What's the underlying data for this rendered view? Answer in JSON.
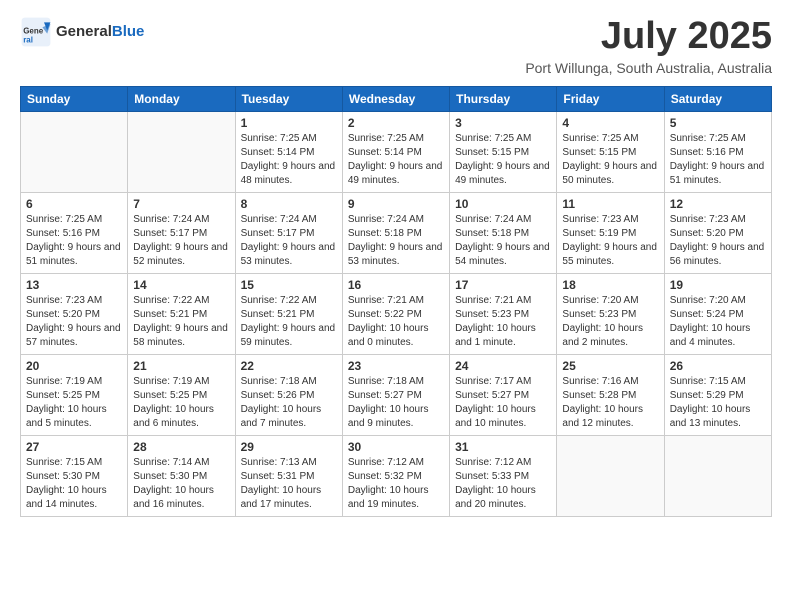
{
  "header": {
    "logo": {
      "general": "General",
      "blue": "Blue"
    },
    "title": "July 2025",
    "location": "Port Willunga, South Australia, Australia"
  },
  "weekdays": [
    "Sunday",
    "Monday",
    "Tuesday",
    "Wednesday",
    "Thursday",
    "Friday",
    "Saturday"
  ],
  "weeks": [
    [
      {
        "day": "",
        "sunrise": "",
        "sunset": "",
        "daylight": ""
      },
      {
        "day": "",
        "sunrise": "",
        "sunset": "",
        "daylight": ""
      },
      {
        "day": "1",
        "sunrise": "Sunrise: 7:25 AM",
        "sunset": "Sunset: 5:14 PM",
        "daylight": "Daylight: 9 hours and 48 minutes."
      },
      {
        "day": "2",
        "sunrise": "Sunrise: 7:25 AM",
        "sunset": "Sunset: 5:14 PM",
        "daylight": "Daylight: 9 hours and 49 minutes."
      },
      {
        "day": "3",
        "sunrise": "Sunrise: 7:25 AM",
        "sunset": "Sunset: 5:15 PM",
        "daylight": "Daylight: 9 hours and 49 minutes."
      },
      {
        "day": "4",
        "sunrise": "Sunrise: 7:25 AM",
        "sunset": "Sunset: 5:15 PM",
        "daylight": "Daylight: 9 hours and 50 minutes."
      },
      {
        "day": "5",
        "sunrise": "Sunrise: 7:25 AM",
        "sunset": "Sunset: 5:16 PM",
        "daylight": "Daylight: 9 hours and 51 minutes."
      }
    ],
    [
      {
        "day": "6",
        "sunrise": "Sunrise: 7:25 AM",
        "sunset": "Sunset: 5:16 PM",
        "daylight": "Daylight: 9 hours and 51 minutes."
      },
      {
        "day": "7",
        "sunrise": "Sunrise: 7:24 AM",
        "sunset": "Sunset: 5:17 PM",
        "daylight": "Daylight: 9 hours and 52 minutes."
      },
      {
        "day": "8",
        "sunrise": "Sunrise: 7:24 AM",
        "sunset": "Sunset: 5:17 PM",
        "daylight": "Daylight: 9 hours and 53 minutes."
      },
      {
        "day": "9",
        "sunrise": "Sunrise: 7:24 AM",
        "sunset": "Sunset: 5:18 PM",
        "daylight": "Daylight: 9 hours and 53 minutes."
      },
      {
        "day": "10",
        "sunrise": "Sunrise: 7:24 AM",
        "sunset": "Sunset: 5:18 PM",
        "daylight": "Daylight: 9 hours and 54 minutes."
      },
      {
        "day": "11",
        "sunrise": "Sunrise: 7:23 AM",
        "sunset": "Sunset: 5:19 PM",
        "daylight": "Daylight: 9 hours and 55 minutes."
      },
      {
        "day": "12",
        "sunrise": "Sunrise: 7:23 AM",
        "sunset": "Sunset: 5:20 PM",
        "daylight": "Daylight: 9 hours and 56 minutes."
      }
    ],
    [
      {
        "day": "13",
        "sunrise": "Sunrise: 7:23 AM",
        "sunset": "Sunset: 5:20 PM",
        "daylight": "Daylight: 9 hours and 57 minutes."
      },
      {
        "day": "14",
        "sunrise": "Sunrise: 7:22 AM",
        "sunset": "Sunset: 5:21 PM",
        "daylight": "Daylight: 9 hours and 58 minutes."
      },
      {
        "day": "15",
        "sunrise": "Sunrise: 7:22 AM",
        "sunset": "Sunset: 5:21 PM",
        "daylight": "Daylight: 9 hours and 59 minutes."
      },
      {
        "day": "16",
        "sunrise": "Sunrise: 7:21 AM",
        "sunset": "Sunset: 5:22 PM",
        "daylight": "Daylight: 10 hours and 0 minutes."
      },
      {
        "day": "17",
        "sunrise": "Sunrise: 7:21 AM",
        "sunset": "Sunset: 5:23 PM",
        "daylight": "Daylight: 10 hours and 1 minute."
      },
      {
        "day": "18",
        "sunrise": "Sunrise: 7:20 AM",
        "sunset": "Sunset: 5:23 PM",
        "daylight": "Daylight: 10 hours and 2 minutes."
      },
      {
        "day": "19",
        "sunrise": "Sunrise: 7:20 AM",
        "sunset": "Sunset: 5:24 PM",
        "daylight": "Daylight: 10 hours and 4 minutes."
      }
    ],
    [
      {
        "day": "20",
        "sunrise": "Sunrise: 7:19 AM",
        "sunset": "Sunset: 5:25 PM",
        "daylight": "Daylight: 10 hours and 5 minutes."
      },
      {
        "day": "21",
        "sunrise": "Sunrise: 7:19 AM",
        "sunset": "Sunset: 5:25 PM",
        "daylight": "Daylight: 10 hours and 6 minutes."
      },
      {
        "day": "22",
        "sunrise": "Sunrise: 7:18 AM",
        "sunset": "Sunset: 5:26 PM",
        "daylight": "Daylight: 10 hours and 7 minutes."
      },
      {
        "day": "23",
        "sunrise": "Sunrise: 7:18 AM",
        "sunset": "Sunset: 5:27 PM",
        "daylight": "Daylight: 10 hours and 9 minutes."
      },
      {
        "day": "24",
        "sunrise": "Sunrise: 7:17 AM",
        "sunset": "Sunset: 5:27 PM",
        "daylight": "Daylight: 10 hours and 10 minutes."
      },
      {
        "day": "25",
        "sunrise": "Sunrise: 7:16 AM",
        "sunset": "Sunset: 5:28 PM",
        "daylight": "Daylight: 10 hours and 12 minutes."
      },
      {
        "day": "26",
        "sunrise": "Sunrise: 7:15 AM",
        "sunset": "Sunset: 5:29 PM",
        "daylight": "Daylight: 10 hours and 13 minutes."
      }
    ],
    [
      {
        "day": "27",
        "sunrise": "Sunrise: 7:15 AM",
        "sunset": "Sunset: 5:30 PM",
        "daylight": "Daylight: 10 hours and 14 minutes."
      },
      {
        "day": "28",
        "sunrise": "Sunrise: 7:14 AM",
        "sunset": "Sunset: 5:30 PM",
        "daylight": "Daylight: 10 hours and 16 minutes."
      },
      {
        "day": "29",
        "sunrise": "Sunrise: 7:13 AM",
        "sunset": "Sunset: 5:31 PM",
        "daylight": "Daylight: 10 hours and 17 minutes."
      },
      {
        "day": "30",
        "sunrise": "Sunrise: 7:12 AM",
        "sunset": "Sunset: 5:32 PM",
        "daylight": "Daylight: 10 hours and 19 minutes."
      },
      {
        "day": "31",
        "sunrise": "Sunrise: 7:12 AM",
        "sunset": "Sunset: 5:33 PM",
        "daylight": "Daylight: 10 hours and 20 minutes."
      },
      {
        "day": "",
        "sunrise": "",
        "sunset": "",
        "daylight": ""
      },
      {
        "day": "",
        "sunrise": "",
        "sunset": "",
        "daylight": ""
      }
    ]
  ]
}
